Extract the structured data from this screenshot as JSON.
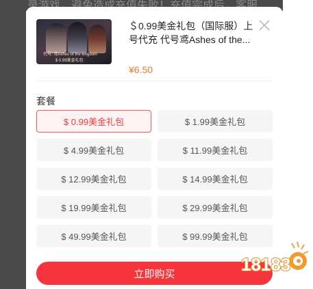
{
  "background": {
    "text": "录游戏，避免造成充值失败！充值完成后，客服"
  },
  "product": {
    "title_line1": "＄0.99美金礼包（国际服）上",
    "title_line2": "号代充 代号鸢Ashes of the...",
    "price": "¥6.50",
    "thumbnail_caption_line1": "代号: 鸢Ashes of the kingdom",
    "thumbnail_caption_line2": "$ 0.99美金礼包"
  },
  "section": {
    "label": "套餐"
  },
  "options": [
    {
      "label": "$ 0.99美金礼包",
      "selected": true
    },
    {
      "label": "$ 1.99美金礼包",
      "selected": false
    },
    {
      "label": "$ 4.99美金礼包",
      "selected": false
    },
    {
      "label": "$ 11.99美金礼包",
      "selected": false
    },
    {
      "label": "$ 12.99美金礼包",
      "selected": false
    },
    {
      "label": "$ 14.99美金礼包",
      "selected": false
    },
    {
      "label": "$ 19.99美金礼包",
      "selected": false
    },
    {
      "label": "$ 29.99美金礼包",
      "selected": false
    },
    {
      "label": "$ 49.99美金礼包",
      "selected": false
    },
    {
      "label": "$ 99.99美金礼包",
      "selected": false
    }
  ],
  "buy_button": {
    "label": "立即购买"
  },
  "watermark": {
    "text": "18183"
  },
  "colors": {
    "accent": "#f6343c",
    "price": "#ee7a2c",
    "selected_border": "#f15a5a"
  },
  "icons": {
    "close": "close-icon"
  }
}
